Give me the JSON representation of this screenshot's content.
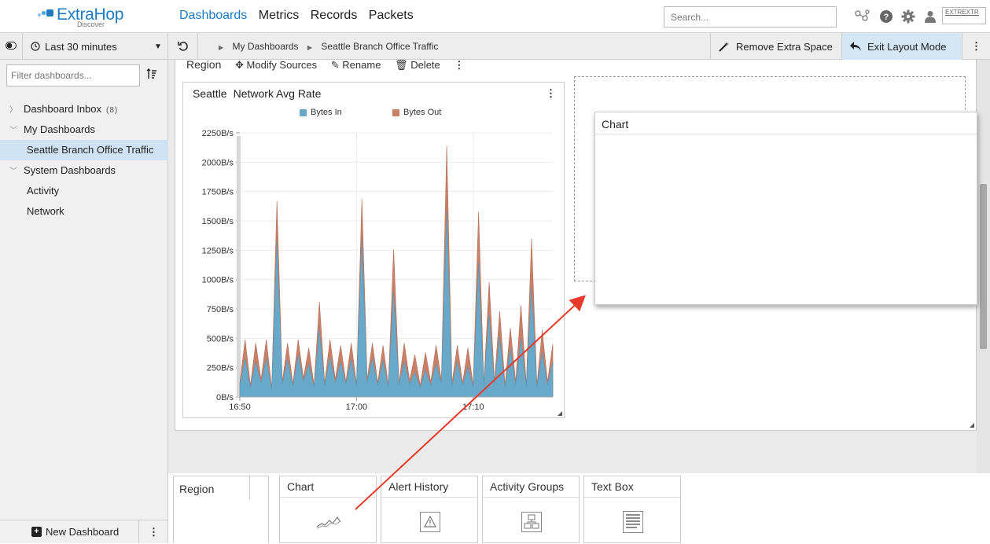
{
  "app": {
    "brand": "ExtraHop",
    "brand_sub": "Discover"
  },
  "nav": {
    "items": [
      "Dashboards",
      "Metrics",
      "Records",
      "Packets"
    ],
    "active": "Dashboards"
  },
  "search": {
    "placeholder": "Search..."
  },
  "header_icons": [
    "network-icon",
    "help-icon",
    "settings-icon",
    "user-icon"
  ],
  "account": {
    "label": "EXTREXTR"
  },
  "toolbar": {
    "time_range": "Last 30 minutes",
    "breadcrumb": [
      "My Dashboards",
      "Seattle Branch Office Traffic"
    ],
    "remove_space_label": "Remove Extra Space",
    "exit_layout_label": "Exit Layout Mode"
  },
  "sidebar": {
    "filter_placeholder": "Filter dashboards...",
    "items": [
      {
        "label": "Dashboard Inbox",
        "badge": "(8)",
        "kind": "folder-collapsed"
      },
      {
        "label": "My Dashboards",
        "kind": "folder-expanded"
      },
      {
        "label": "Seattle Branch Office Traffic",
        "kind": "dashboard",
        "selected": true
      },
      {
        "label": "System Dashboards",
        "kind": "folder-expanded"
      },
      {
        "label": "Activity",
        "kind": "dashboard"
      },
      {
        "label": "Network",
        "kind": "dashboard"
      }
    ],
    "new_dashboard_label": "New Dashboard"
  },
  "region": {
    "title": "Region",
    "actions": [
      "Modify Sources",
      "Rename",
      "Delete"
    ]
  },
  "widget": {
    "source": "Seattle",
    "metric": "Network Avg Rate"
  },
  "drop_target": {
    "title": "Chart"
  },
  "palette": {
    "region_label": "Region",
    "cards": [
      "Chart",
      "Alert History",
      "Activity Groups",
      "Text Box"
    ]
  },
  "colors": {
    "bytes_in": "#68a8c8",
    "bytes_out": "#c98067",
    "accent": "#1f7bc1",
    "selected": "#cfe3f4"
  },
  "chart_data": {
    "type": "area",
    "stacked": true,
    "title": "",
    "x_ticks": [
      "16:50",
      "17:00",
      "17:10"
    ],
    "y_ticks": [
      "0B/s",
      "250B/s",
      "500B/s",
      "750B/s",
      "1000B/s",
      "1250B/s",
      "1500B/s",
      "1750B/s",
      "2000B/s",
      "2250B/s"
    ],
    "ylim": [
      0,
      2250
    ],
    "ylabel": "",
    "xlabel": "",
    "legend_position": "top",
    "grid": true,
    "series": [
      {
        "name": "Bytes In",
        "color": "#68a8c8",
        "values": [
          100,
          330,
          80,
          300,
          120,
          330,
          60,
          1340,
          110,
          320,
          90,
          360,
          130,
          280,
          80,
          580,
          100,
          340,
          120,
          300,
          110,
          320,
          90,
          1350,
          120,
          330,
          100,
          310,
          80,
          900,
          100,
          300,
          110,
          210,
          80,
          230,
          100,
          280,
          120,
          1590,
          90,
          300,
          100,
          260,
          80,
          1150,
          90,
          700,
          100,
          520,
          80,
          420,
          100,
          500,
          90,
          940,
          80,
          380,
          100,
          300
        ]
      },
      {
        "name": "Bytes Out",
        "color": "#c98067",
        "values": [
          20,
          160,
          20,
          160,
          30,
          160,
          20,
          330,
          20,
          140,
          20,
          130,
          30,
          140,
          20,
          230,
          20,
          150,
          30,
          140,
          20,
          140,
          20,
          340,
          30,
          130,
          20,
          130,
          20,
          360,
          20,
          160,
          30,
          150,
          20,
          150,
          30,
          160,
          20,
          550,
          30,
          140,
          20,
          160,
          20,
          430,
          20,
          280,
          30,
          210,
          20,
          170,
          30,
          280,
          20,
          410,
          20,
          190,
          30,
          150
        ]
      }
    ]
  }
}
